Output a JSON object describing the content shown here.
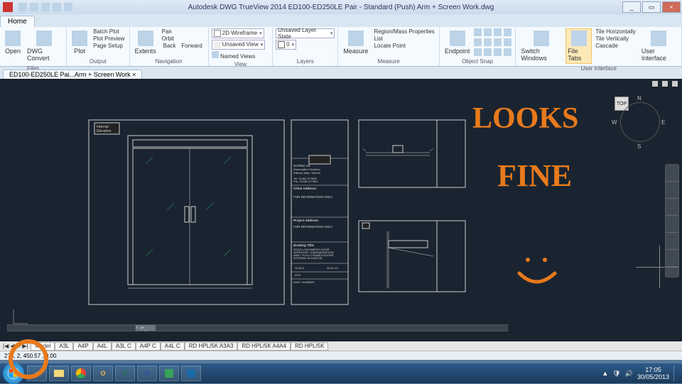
{
  "app": {
    "title": "Autodesk DWG TrueView 2014     ED100-ED250LE Pair - Standard (Push) Arm + Screen Work.dwg"
  },
  "qat_tips": [
    "new",
    "open",
    "save",
    "undo",
    "redo"
  ],
  "win_buttons": {
    "min": "_",
    "max": "▭",
    "close": "×"
  },
  "file_tab": "ED100-ED250LE Pai...Arm + Screen Work ×",
  "ribbon": {
    "tab": "Home",
    "groups": {
      "files": {
        "label": "Files",
        "open": "Open",
        "dwg_convert": "DWG Convert"
      },
      "output": {
        "label": "Output",
        "plot": "Plot",
        "batch": "Batch Plot",
        "preview": "Plot Preview",
        "page": "Page Setup"
      },
      "navigation": {
        "label": "Navigation",
        "extents": "Extents",
        "pan": "Pan",
        "orbit": "Orbit",
        "back": "Back",
        "fwd": "Forward"
      },
      "view": {
        "label": "View",
        "style": "2D Wireframe",
        "unsaved": "Unsaved View",
        "named": "Named Views"
      },
      "layers": {
        "label": "Layers",
        "state": "Unsaved Layer State",
        "layer0": "0"
      },
      "measure": {
        "label": "Measure",
        "measure": "Measure",
        "region": "Region/Mass Properties",
        "list": "List",
        "locate": "Locate Point"
      },
      "osnap": {
        "label": "Object Snap",
        "endpoint": "Endpoint"
      },
      "ui": {
        "label": "User Interface",
        "switch": "Switch Windows",
        "filetabs": "File Tabs",
        "tileh": "Tile Horizontally",
        "tilev": "Tile Vertically",
        "cascade": "Cascade",
        "uibtn": "User Interface"
      }
    }
  },
  "viewcube": {
    "n": "N",
    "s": "S",
    "e": "E",
    "w": "W",
    "top": "TOP"
  },
  "titleblock": {
    "company": "DORMA UK",
    "division": "(Automatics Division)",
    "addr1": "Wilbury Way / Hitchin",
    "tel": "Tel: 01462 477600",
    "fax": "Fax: 01462 477601",
    "client_h": "Client Address:",
    "info": "FOR INFORMATION ONLY",
    "proj_h": "Project Address:",
    "proj": "FOR INFORMATION ONLY",
    "dtitle_h": "Drawing Title:",
    "dtitle": "ED100 / LOW ENERGY DOOR OPERATOR. STANDARD(PUSH) ARM + FULLY FRAMED DOORS. INTERNAL ELEVATION",
    "date": "26.04.13",
    "scale": "SCALE: NTS",
    "dwgno": "DWG. NUMBER"
  },
  "label_ie": "Internal\nElevation",
  "annot1": "LOOKS",
  "annot2": "FINE",
  "layout_tabs": [
    "Model",
    "A3L",
    "A4P",
    "A4L",
    "A3L C",
    "A4P C",
    "A4L C",
    "RD HPL/5K A3A3",
    "RD HPL/5K A4A4",
    "RD HPL/5K"
  ],
  "layout_nav": "|◀ ◀ ▶ ▶|",
  "coords": "273,     2, 450.57 , 0.00",
  "clock": {
    "time": "17:05",
    "date": "30/05/2013"
  },
  "tb_icons": [
    "ie",
    "folder",
    "chrome",
    "outlook",
    "excel",
    "word",
    "dwg",
    "dwg2"
  ]
}
